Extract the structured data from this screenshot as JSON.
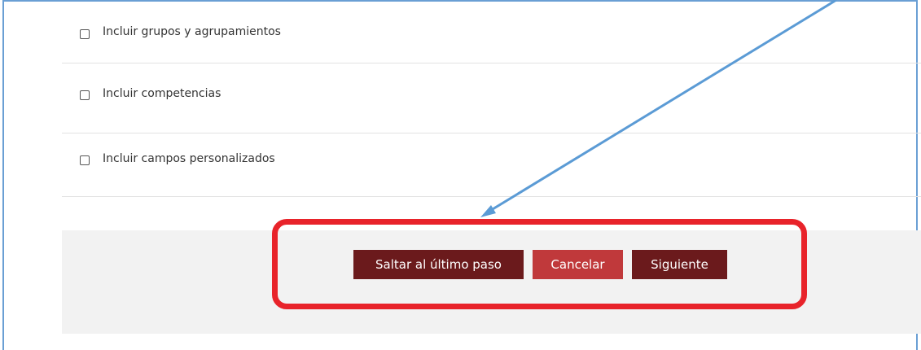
{
  "options": [
    {
      "label": "Incluir grupos y agrupamientos",
      "checked": false
    },
    {
      "label": "Incluir competencias",
      "checked": false
    },
    {
      "label": "Incluir campos personalizados",
      "checked": false
    }
  ],
  "buttons": {
    "skip_label": "Saltar al último paso",
    "cancel_label": "Cancelar",
    "next_label": "Siguiente"
  },
  "colors": {
    "primary_button": "#6b1a1c",
    "secondary_button": "#c0393b",
    "highlight_box": "#e8232a",
    "annotation_arrow": "#5b9bd5"
  },
  "annotation": {
    "arrow_icon": "arrow-pointer-icon",
    "highlight": "highlight-box"
  }
}
